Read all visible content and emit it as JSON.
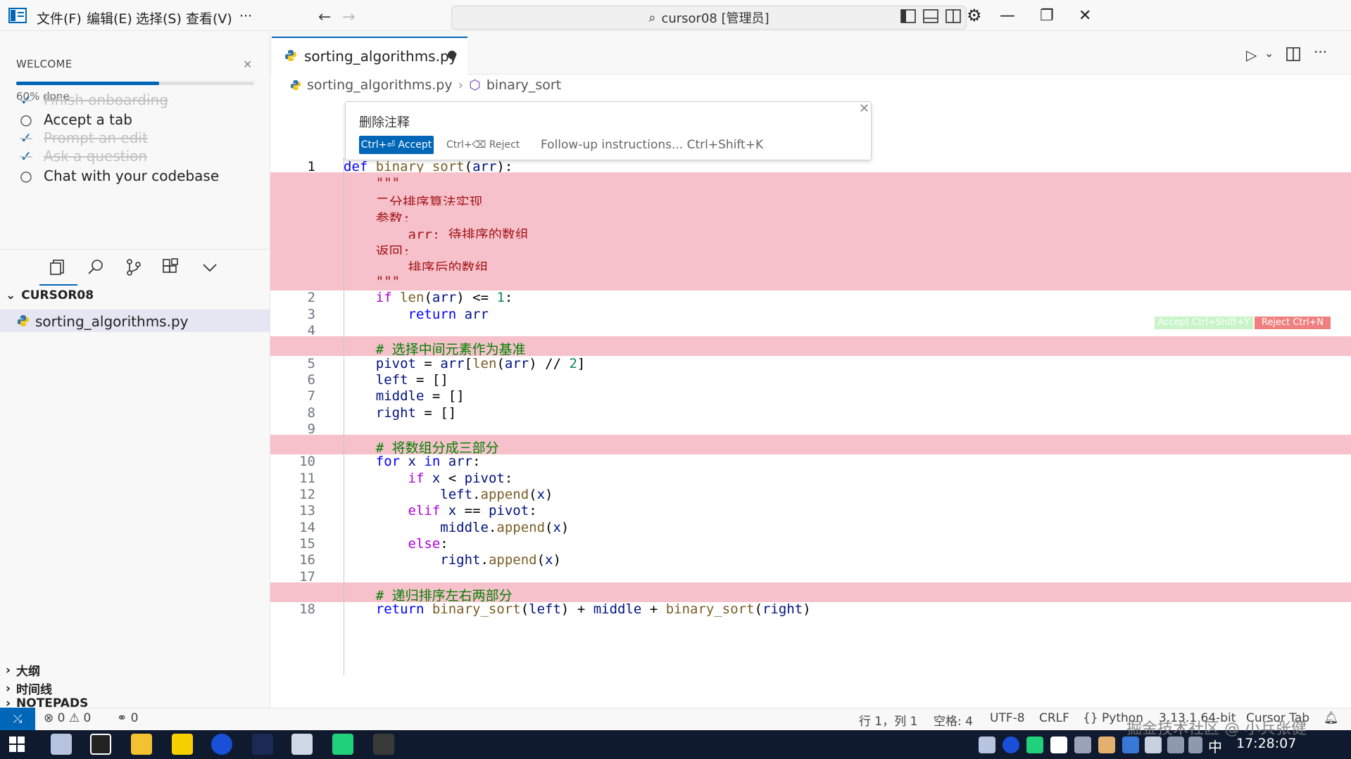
{
  "titlebar": {
    "menus": [
      "文件(F)",
      "编辑(E)",
      "选择(S)",
      "查看(V)",
      "···"
    ],
    "search_text": "cursor08 [管理员]"
  },
  "welcome": {
    "title": "WELCOME",
    "progress_text": "60% done",
    "progress": 0.6,
    "tasks": [
      {
        "label": "Finish onboarding",
        "done": true
      },
      {
        "label": "Accept a tab",
        "done": false
      },
      {
        "label": "Prompt an edit",
        "done": true
      },
      {
        "label": "Ask a question",
        "done": true
      },
      {
        "label": "Chat with your codebase",
        "done": false
      }
    ]
  },
  "explorer": {
    "folder": "CURSOR08",
    "file": "sorting_algorithms.py",
    "sections": [
      "大纲",
      "时间线",
      "NOTEPADS"
    ]
  },
  "editor": {
    "tab_label": "sorting_algorithms.py",
    "breadcrumb": [
      "sorting_algorithms.py",
      "binary_sort"
    ]
  },
  "popup": {
    "title": "删除注释",
    "accept": "Ctrl+⏎ Accept",
    "reject": "Ctrl+⌫ Reject",
    "followup": "Follow-up instructions... Ctrl+Shift+K"
  },
  "inline_actions": {
    "accept": "Accept Ctrl+Shift+Y",
    "reject": "Reject Ctrl+N"
  },
  "code_lines": [
    {
      "n": "1",
      "text": "def binary_sort(arr):",
      "removed": false
    },
    {
      "n": "",
      "text": "    \"\"\"",
      "removed": true
    },
    {
      "n": "",
      "text": "    二分排序算法实现",
      "removed": true
    },
    {
      "n": "",
      "text": "    参数:",
      "removed": true
    },
    {
      "n": "",
      "text": "        arr: 待排序的数组",
      "removed": true
    },
    {
      "n": "",
      "text": "    返回:",
      "removed": true
    },
    {
      "n": "",
      "text": "        排序后的数组",
      "removed": true
    },
    {
      "n": "",
      "text": "    \"\"\"",
      "removed": true
    },
    {
      "n": "2",
      "text": "    if len(arr) <= 1:",
      "removed": false
    },
    {
      "n": "3",
      "text": "        return arr",
      "removed": false
    },
    {
      "n": "4",
      "text": "",
      "removed": false
    },
    {
      "n": "",
      "text": "    # 选择中间元素作为基准",
      "removed": true
    },
    {
      "n": "5",
      "text": "    pivot = arr[len(arr) // 2]",
      "removed": false
    },
    {
      "n": "6",
      "text": "    left = []",
      "removed": false
    },
    {
      "n": "7",
      "text": "    middle = []",
      "removed": false
    },
    {
      "n": "8",
      "text": "    right = []",
      "removed": false
    },
    {
      "n": "9",
      "text": "",
      "removed": false
    },
    {
      "n": "",
      "text": "    # 将数组分成三部分",
      "removed": true
    },
    {
      "n": "10",
      "text": "    for x in arr:",
      "removed": false
    },
    {
      "n": "11",
      "text": "        if x < pivot:",
      "removed": false
    },
    {
      "n": "12",
      "text": "            left.append(x)",
      "removed": false
    },
    {
      "n": "13",
      "text": "        elif x == pivot:",
      "removed": false
    },
    {
      "n": "14",
      "text": "            middle.append(x)",
      "removed": false
    },
    {
      "n": "15",
      "text": "        else:",
      "removed": false
    },
    {
      "n": "16",
      "text": "            right.append(x)",
      "removed": false
    },
    {
      "n": "17",
      "text": "",
      "removed": false
    },
    {
      "n": "",
      "text": "    # 递归排序左右两部分",
      "removed": true
    },
    {
      "n": "18",
      "text": "    return binary_sort(left) + middle + binary_sort(right)",
      "removed": false
    }
  ],
  "statusbar": {
    "errors": "0",
    "warnings": "0",
    "ports": "0",
    "position": "行 1，列 1",
    "spaces": "空格: 4",
    "encoding": "UTF-8",
    "eol": "CRLF",
    "language": "Python",
    "interpreter": "3.13.1 64-bit",
    "cursor_tab": "Cursor Tab"
  },
  "taskbar": {
    "ime": "中",
    "time": "17:28:07"
  },
  "watermark": "掘金技术社区 @ 小兵张健",
  "colors": {
    "accent": "#0066b8",
    "removed_bg": "#f7c1cc",
    "taskbar": "#101a2e"
  }
}
